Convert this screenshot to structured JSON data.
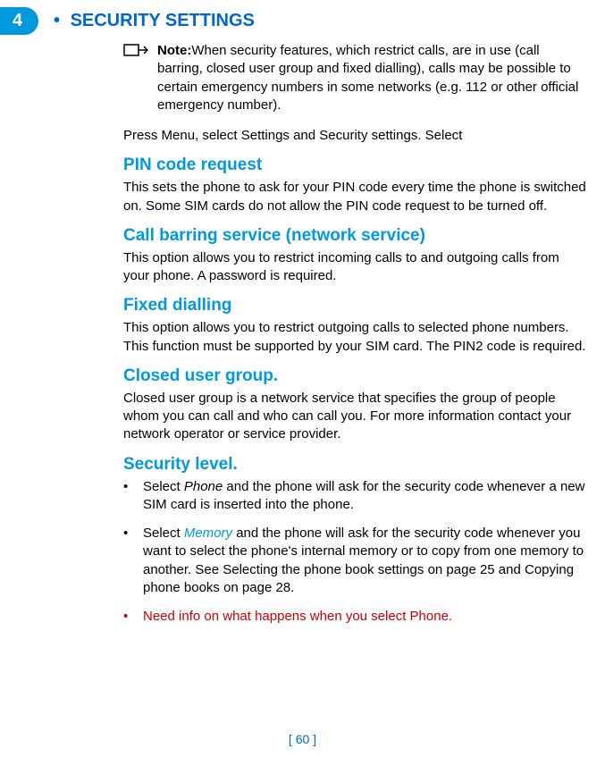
{
  "page_tab_number": "4",
  "main_heading_bullet": " • ",
  "main_heading": "SECURITY SETTINGS",
  "note": {
    "label": "Note:",
    "text": "When security features, which restrict calls, are in use (call barring, closed user group and fixed dialling), calls may be possible to certain emergency numbers in some networks (e.g.  112 or other official emergency number)."
  },
  "intro_text": "Press Menu, select Settings and Security settings. Select",
  "sections": {
    "pin": {
      "heading": "PIN code request",
      "body": "This sets the phone to ask for your PIN code every time the phone is switched on. Some SIM cards do not allow the PIN code request to be turned off."
    },
    "call_barring": {
      "heading": "Call barring service (network service)",
      "body": "This option allows you to restrict incoming calls to and outgoing calls from your phone. A password is required."
    },
    "fixed_dialling": {
      "heading": "Fixed dialling",
      "body": "This option allows you to restrict outgoing calls to selected phone numbers. This function must be supported by your SIM card. The PIN2 code is required."
    },
    "closed_user_group": {
      "heading": "Closed user group.",
      "body": "Closed user group is a network service that specifies the group of people whom you can call and who can call you. For more information contact your network operator or service provider."
    },
    "security_level": {
      "heading": "Security level.",
      "bullet1_prefix": "Select ",
      "bullet1_italic": "Phone",
      "bullet1_suffix": " and the phone will ask for the security code whenever a new SIM card is inserted into the phone.",
      "bullet2_prefix": "Select ",
      "bullet2_link": "Memory",
      "bullet2_suffix": " and the phone will ask for the security code whenever you want to select the phone's internal memory or to copy from one memory to another. See Selecting the phone book settings on page 25 and Copying phone books on page 28.",
      "bullet3": "Need info on what happens when you select Phone."
    }
  },
  "footer": "[ 60 ]"
}
